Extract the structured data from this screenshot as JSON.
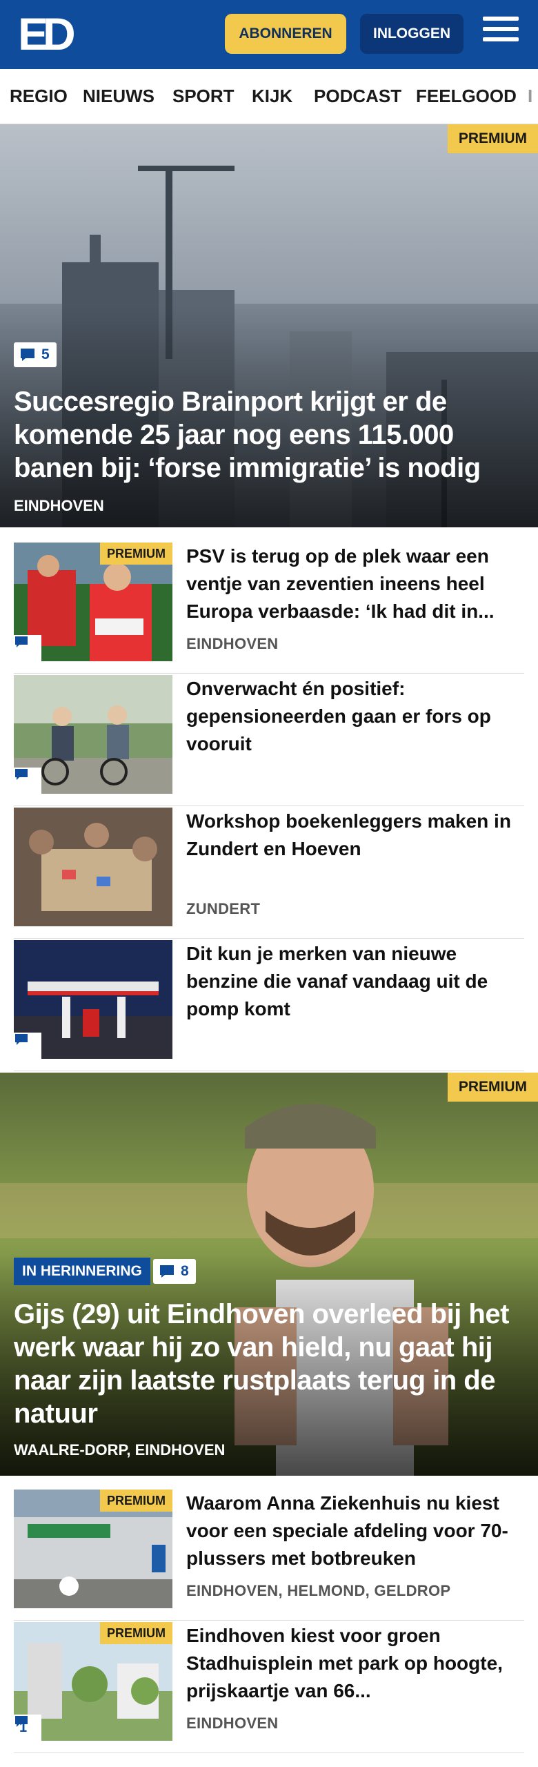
{
  "header": {
    "logo": "ED",
    "subscribe_label": "ABONNEREN",
    "login_label": "INLOGGEN",
    "colors": {
      "brand_blue": "#0f4c9c",
      "premium_yellow": "#f2c94c"
    }
  },
  "nav": {
    "items": [
      "REGIO",
      "NIEUWS",
      "SPORT",
      "KIJK",
      "PODCAST",
      "FEELGOOD",
      "I"
    ]
  },
  "hero1": {
    "premium": "PREMIUM",
    "comments": "5",
    "title": "Succesregio Brainport krijgt er de komende 25 jaar nog eens 115.000 banen bij: ‘forse immigratie’ is nodig",
    "category": "EINDHOVEN"
  },
  "articles1": [
    {
      "premium": "PREMIUM",
      "title": "PSV is terug op de plek waar een ventje van zeventien ineens heel Europa verbaasde: ‘Ik had dit in...",
      "category": "EINDHOVEN"
    },
    {
      "title": "Onverwacht én positief: gepensioneerden gaan er fors op vooruit"
    },
    {
      "title": "Workshop boekenleggers maken in Zundert en Hoeven",
      "category": "ZUNDERT"
    },
    {
      "title": "Dit kun je merken van nieuwe benzine die vanaf vandaag uit de pomp komt"
    }
  ],
  "hero2": {
    "premium": "PREMIUM",
    "tag": "IN HERINNERING",
    "comments": "8",
    "title": "Gijs (29) uit Eindhoven overleed bij het werk waar hij zo van hield, nu gaat hij naar zijn laatste rustplaats terug in de natuur",
    "category": "WAALRE-DORP, EINDHOVEN"
  },
  "articles2": [
    {
      "premium": "PREMIUM",
      "title": "Waarom Anna Ziekenhuis nu kiest voor een speciale afdeling voor 70-plussers met botbreuken",
      "category": "EINDHOVEN, HELMOND, GELDROP"
    },
    {
      "premium": "PREMIUM",
      "comments": "1",
      "title": "Eindhoven kiest voor groen Stadhuisplein met park op hoogte, prijskaartje van 66...",
      "category": "EINDHOVEN"
    }
  ]
}
